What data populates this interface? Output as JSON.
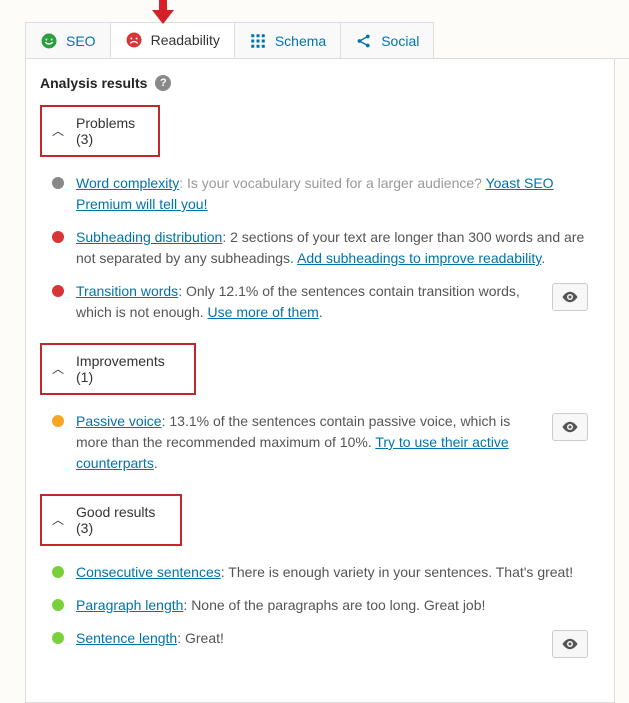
{
  "arrow_color": "#d62027",
  "tabs": {
    "seo": "SEO",
    "readability": "Readability",
    "schema": "Schema",
    "social": "Social"
  },
  "header": {
    "title": "Analysis results",
    "help": "?"
  },
  "sections": {
    "problems": {
      "label": "Problems ",
      "count": "(3)",
      "items": [
        {
          "bullet": "gray",
          "link1": "Word complexity",
          "text1_muted_prefix": ": ",
          "text1_muted": "Is your vocabulary suited for a larger audience? ",
          "link2": "Yoast SEO Premium will tell you!",
          "eye": false
        },
        {
          "bullet": "red",
          "link1": "Subheading distribution",
          "text1": ": 2 sections of your text are longer than 300 words and are not separated by any subheadings. ",
          "link2": "Add subheadings to improve readability",
          "suffix": ".",
          "eye": false
        },
        {
          "bullet": "red",
          "link1": "Transition words",
          "text1": ": Only 12.1% of the sentences contain transition words, which is not enough. ",
          "link2": "Use more of them",
          "suffix": ".",
          "eye": true
        }
      ]
    },
    "improvements": {
      "label": "Improvements ",
      "count": "(1)",
      "items": [
        {
          "bullet": "orange",
          "link1": "Passive voice",
          "text1": ": 13.1% of the sentences contain passive voice, which is more than the recommended maximum of 10%. ",
          "link2": "Try to use their active counterparts",
          "suffix": ".",
          "eye": true
        }
      ]
    },
    "good": {
      "label": "Good results ",
      "count": "(3)",
      "items": [
        {
          "bullet": "green",
          "link1": "Consecutive sentences",
          "text1": ": There is enough variety in your sentences. That's great!",
          "eye": false
        },
        {
          "bullet": "green",
          "link1": "Paragraph length",
          "text1": ": None of the paragraphs are too long. Great job!",
          "eye": false
        },
        {
          "bullet": "green",
          "link1": "Sentence length",
          "text1": ": Great!",
          "eye": true
        }
      ]
    }
  }
}
